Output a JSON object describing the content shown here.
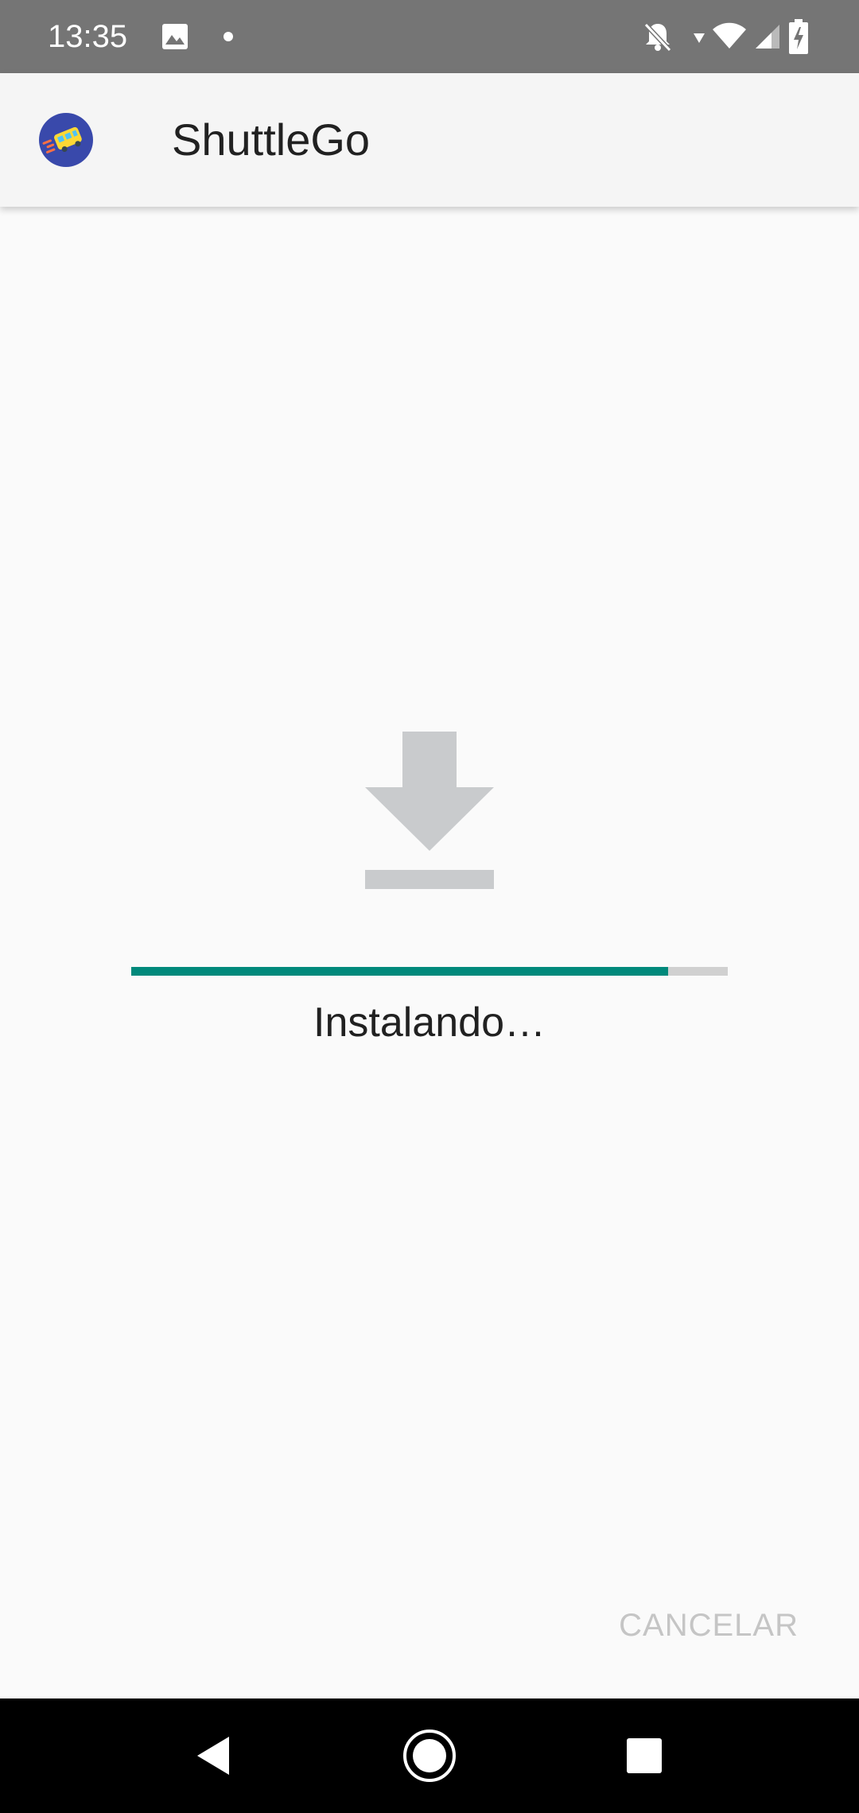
{
  "status_bar": {
    "time": "13:35",
    "icons": [
      "image-icon",
      "dot-icon",
      "notifications-off-icon",
      "data-arrow-icon",
      "wifi-icon",
      "signal-icon",
      "battery-charging-icon"
    ]
  },
  "app_bar": {
    "title": "ShuttleGo",
    "logo_icon": "shuttle-logo-icon"
  },
  "install": {
    "icon": "download-icon",
    "progress": 0.9,
    "status": "Instalando…",
    "cancel_label": "CANCELAR"
  },
  "nav_bar": {
    "buttons": [
      "back-icon",
      "home-icon",
      "recents-icon"
    ]
  },
  "colors": {
    "status_bar_bg": "#757575",
    "app_bar_bg": "#f5f5f5",
    "accent": "#00897b",
    "progress_track": "#d0d0d0",
    "icon_gray": "#c9cbcd",
    "cancel_disabled": "#c5c5c5"
  }
}
